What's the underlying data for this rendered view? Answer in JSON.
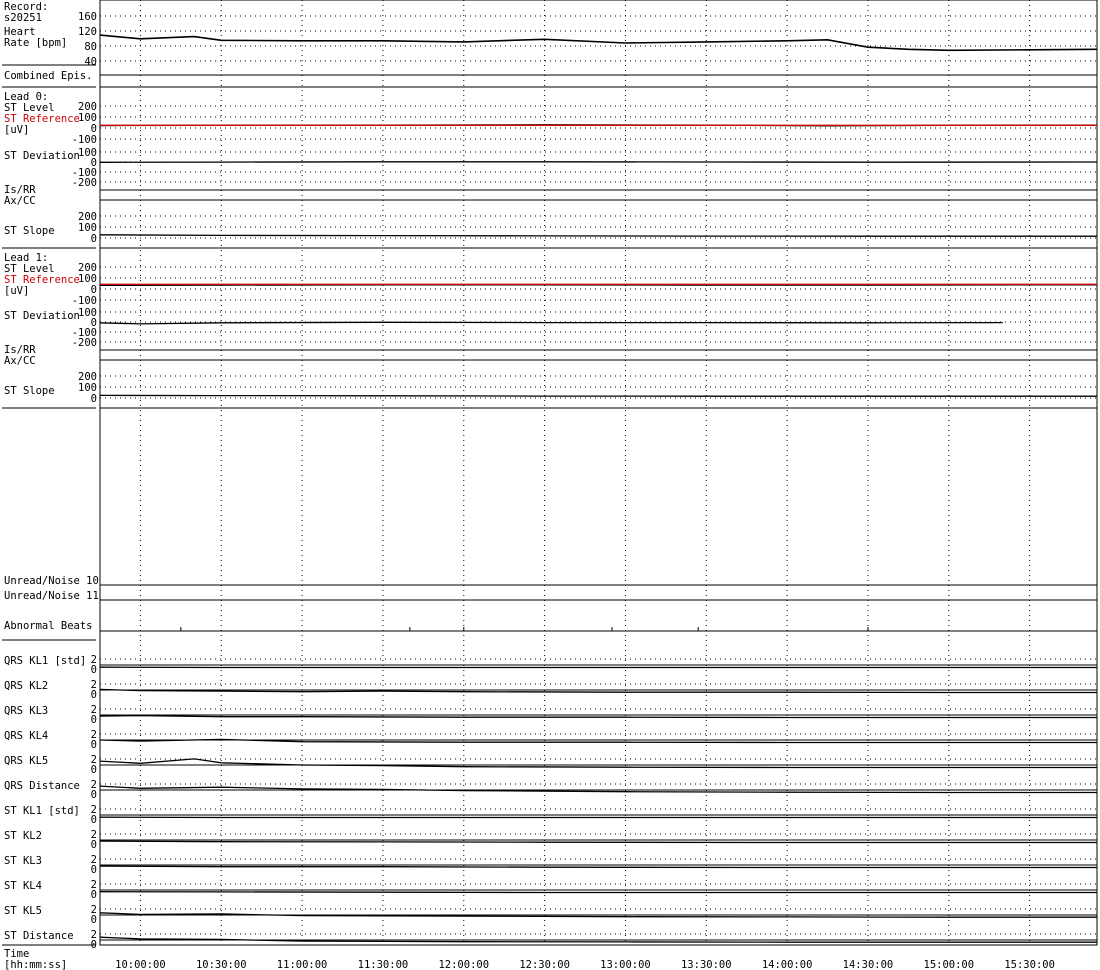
{
  "record": {
    "label": "Record:",
    "id": "s20251"
  },
  "time_axis": {
    "label_line1": "Time",
    "label_line2": "[hh:mm:ss]",
    "ticks": [
      "10:00:00",
      "10:30:00",
      "11:00:00",
      "11:30:00",
      "12:00:00",
      "12:30:00",
      "13:00:00",
      "13:30:00",
      "14:00:00",
      "14:30:00",
      "15:00:00",
      "15:30:00"
    ]
  },
  "colors": {
    "trace": "#000000",
    "reference": "#cc0000",
    "grid": "#000000"
  },
  "panels": [
    {
      "key": "hr",
      "labels": [
        "Heart",
        "Rate [bpm]"
      ],
      "ticks": [
        "160",
        "120",
        "80",
        "40"
      ]
    },
    {
      "key": "combined",
      "labels": [
        "Combined Epis."
      ],
      "ticks": []
    },
    {
      "key": "lead0_level",
      "labels": [
        "Lead 0:",
        "ST Level",
        "ST Reference",
        "[uV]"
      ],
      "ref_label_index": 2,
      "ticks": [
        "200",
        "100",
        "0",
        "-100"
      ]
    },
    {
      "key": "lead0_dev",
      "labels": [
        "ST Deviation"
      ],
      "ticks": [
        "100",
        "0",
        "-100",
        "-200"
      ]
    },
    {
      "key": "lead0_isrr",
      "labels": [
        "Is/RR",
        "Ax/CC"
      ],
      "ticks": []
    },
    {
      "key": "lead0_slope",
      "labels": [
        "ST Slope"
      ],
      "ticks": [
        "200",
        "100",
        "0"
      ]
    },
    {
      "key": "lead1_level",
      "labels": [
        "Lead 1:",
        "ST Level",
        "ST Reference",
        "[uV]"
      ],
      "ref_label_index": 2,
      "ticks": [
        "200",
        "100",
        "0",
        "-100"
      ]
    },
    {
      "key": "lead1_dev",
      "labels": [
        "ST Deviation"
      ],
      "ticks": [
        "100",
        "0",
        "-100",
        "-200"
      ]
    },
    {
      "key": "lead1_isrr",
      "labels": [
        "Is/RR",
        "Ax/CC"
      ],
      "ticks": []
    },
    {
      "key": "lead1_slope",
      "labels": [
        "ST Slope"
      ],
      "ticks": [
        "200",
        "100",
        "0"
      ]
    },
    {
      "key": "empty",
      "labels": [],
      "ticks": []
    },
    {
      "key": "noise10",
      "labels": [
        "Unread/Noise 10"
      ],
      "ticks": []
    },
    {
      "key": "noise11",
      "labels": [
        "Unread/Noise 11"
      ],
      "ticks": []
    },
    {
      "key": "abnormal",
      "labels": [
        "Abnormal Beats"
      ],
      "ticks": []
    },
    {
      "key": "qrs_kl1",
      "labels": [
        "QRS KL1 [std]"
      ],
      "ticks": [
        "2",
        "0"
      ]
    },
    {
      "key": "qrs_kl2",
      "labels": [
        "QRS KL2"
      ],
      "ticks": [
        "2",
        "0"
      ]
    },
    {
      "key": "qrs_kl3",
      "labels": [
        "QRS KL3"
      ],
      "ticks": [
        "2",
        "0"
      ]
    },
    {
      "key": "qrs_kl4",
      "labels": [
        "QRS KL4"
      ],
      "ticks": [
        "2",
        "0"
      ]
    },
    {
      "key": "qrs_kl5",
      "labels": [
        "QRS KL5"
      ],
      "ticks": [
        "2",
        "0"
      ]
    },
    {
      "key": "qrs_dist",
      "labels": [
        "QRS Distance"
      ],
      "ticks": [
        "2",
        "0"
      ]
    },
    {
      "key": "st_kl1",
      "labels": [
        "ST KL1 [std]"
      ],
      "ticks": [
        "2",
        "0"
      ]
    },
    {
      "key": "st_kl2",
      "labels": [
        "ST KL2"
      ],
      "ticks": [
        "2",
        "0"
      ]
    },
    {
      "key": "st_kl3",
      "labels": [
        "ST KL3"
      ],
      "ticks": [
        "2",
        "0"
      ]
    },
    {
      "key": "st_kl4",
      "labels": [
        "ST KL4"
      ],
      "ticks": [
        "2",
        "0"
      ]
    },
    {
      "key": "st_kl5",
      "labels": [
        "ST KL5"
      ],
      "ticks": [
        "2",
        "0"
      ]
    },
    {
      "key": "st_dist",
      "labels": [
        "ST Distance"
      ],
      "ticks": [
        "2",
        "0"
      ]
    }
  ],
  "chart_data": {
    "type": "line",
    "x_unit": "hh:mm:ss",
    "x_range": [
      "09:45:00",
      "15:55:00"
    ],
    "series": [
      {
        "panel": "hr",
        "range": [
          40,
          160
        ],
        "x": [
          "09:45:00",
          "10:00:00",
          "10:20:00",
          "10:30:00",
          "11:00:00",
          "11:30:00",
          "12:00:00",
          "12:30:00",
          "13:00:00",
          "13:30:00",
          "14:00:00",
          "14:15:00",
          "14:30:00",
          "14:45:00",
          "15:00:00",
          "15:30:00",
          "15:55:00"
        ],
        "values": [
          97,
          90,
          94,
          87,
          86,
          86,
          84,
          89,
          82,
          84,
          86,
          88,
          74,
          70,
          68,
          69,
          70
        ]
      },
      {
        "panel": "lead0_level",
        "range": [
          -150,
          250
        ],
        "x": [
          "09:45:00",
          "10:30:00",
          "11:30:00",
          "12:30:00",
          "13:30:00",
          "14:15:00",
          "15:00:00",
          "15:55:00"
        ],
        "values": [
          -12,
          -10,
          -8,
          -6,
          -8,
          -14,
          -10,
          -8
        ]
      },
      {
        "panel": "lead0_level",
        "role": "reference",
        "range": [
          -150,
          250
        ],
        "x": [
          "09:45:00",
          "15:55:00"
        ],
        "values": [
          -10,
          -10
        ]
      },
      {
        "panel": "lead0_dev",
        "range": [
          -250,
          150
        ],
        "x": [
          "09:45:00",
          "10:30:00",
          "11:30:00",
          "12:30:00",
          "13:30:00",
          "14:30:00",
          "15:55:00"
        ],
        "values": [
          -5,
          -3,
          0,
          0,
          -2,
          -4,
          -2
        ]
      },
      {
        "panel": "lead0_slope",
        "range": [
          -25,
          260
        ],
        "x": [
          "09:45:00",
          "10:30:00",
          "11:30:00",
          "12:30:00",
          "13:30:00",
          "14:30:00",
          "15:55:00"
        ],
        "values": [
          12,
          8,
          6,
          4,
          3,
          2,
          2
        ]
      },
      {
        "panel": "lead1_level",
        "range": [
          -150,
          250
        ],
        "x": [
          "09:45:00",
          "10:30:00",
          "11:30:00",
          "12:30:00",
          "13:30:00",
          "14:30:00",
          "15:55:00"
        ],
        "values": [
          -8,
          -6,
          -4,
          -4,
          -6,
          -6,
          -4
        ]
      },
      {
        "panel": "lead1_level",
        "role": "reference",
        "range": [
          -150,
          250
        ],
        "x": [
          "09:45:00",
          "15:55:00"
        ],
        "values": [
          0,
          0
        ]
      },
      {
        "panel": "lead1_dev",
        "range": [
          -250,
          150
        ],
        "x": [
          "09:45:00",
          "10:00:00",
          "10:30:00",
          "11:30:00",
          "12:30:00",
          "13:30:00",
          "14:30:00",
          "15:20:00"
        ],
        "values": [
          -10,
          -20,
          -10,
          -5,
          -8,
          -8,
          -10,
          -8
        ]
      },
      {
        "panel": "lead1_slope",
        "range": [
          -25,
          260
        ],
        "x": [
          "09:45:00",
          "10:30:00",
          "11:30:00",
          "12:30:00",
          "13:30:00",
          "14:30:00",
          "15:55:00"
        ],
        "values": [
          8,
          6,
          5,
          3,
          2,
          2,
          2
        ]
      },
      {
        "panel": "qrs_kl1",
        "range": [
          -0.4,
          3.2
        ],
        "x": [
          "09:45:00",
          "10:30:00",
          "12:00:00",
          "13:30:00",
          "15:55:00"
        ],
        "values": [
          0.1,
          0.05,
          0.05,
          0.05,
          0.05
        ]
      },
      {
        "panel": "qrs_kl2",
        "range": [
          -0.4,
          3.2
        ],
        "x": [
          "09:45:00",
          "10:00:00",
          "10:30:00",
          "11:00:00",
          "11:30:00",
          "12:00:00",
          "13:00:00",
          "14:00:00",
          "15:00:00",
          "15:55:00"
        ],
        "values": [
          0.6,
          0.4,
          0.3,
          0.2,
          0.3,
          0.2,
          0.1,
          0.1,
          0.05,
          0.05
        ]
      },
      {
        "panel": "qrs_kl3",
        "range": [
          -0.4,
          3.2
        ],
        "x": [
          "09:45:00",
          "10:00:00",
          "10:30:00",
          "11:00:00",
          "12:00:00",
          "13:00:00",
          "14:00:00",
          "15:55:00"
        ],
        "values": [
          0.3,
          0.4,
          0.2,
          0.2,
          0.1,
          0.1,
          0.05,
          0.05
        ]
      },
      {
        "panel": "qrs_kl4",
        "range": [
          -0.4,
          3.2
        ],
        "x": [
          "09:45:00",
          "10:00:00",
          "10:30:00",
          "11:00:00",
          "12:00:00",
          "13:00:00",
          "14:00:00",
          "15:00:00",
          "15:55:00"
        ],
        "values": [
          0.5,
          0.3,
          0.6,
          0.2,
          0.1,
          0.1,
          0.05,
          0.05,
          0.05
        ]
      },
      {
        "panel": "qrs_kl5",
        "range": [
          -0.4,
          3.2
        ],
        "x": [
          "09:45:00",
          "10:00:00",
          "10:20:00",
          "10:30:00",
          "11:00:00",
          "11:30:00",
          "12:00:00",
          "13:00:00",
          "14:00:00",
          "15:55:00"
        ],
        "values": [
          1.2,
          0.8,
          1.6,
          0.9,
          0.5,
          0.4,
          0.2,
          0.1,
          0.05,
          0.05
        ]
      },
      {
        "panel": "qrs_dist",
        "range": [
          -0.4,
          3.2
        ],
        "x": [
          "09:45:00",
          "10:00:00",
          "10:30:00",
          "11:00:00",
          "11:30:00",
          "12:00:00",
          "13:00:00",
          "14:00:00",
          "15:00:00",
          "15:55:00"
        ],
        "values": [
          1.2,
          0.8,
          1.0,
          0.7,
          0.6,
          0.4,
          0.2,
          0.1,
          0.05,
          0.05
        ]
      },
      {
        "panel": "st_kl1",
        "range": [
          -0.4,
          3.2
        ],
        "x": [
          "09:45:00",
          "10:30:00",
          "12:00:00",
          "13:30:00",
          "15:55:00"
        ],
        "values": [
          0.1,
          0.05,
          0.05,
          0.05,
          0.05
        ]
      },
      {
        "panel": "st_kl2",
        "range": [
          -0.4,
          3.2
        ],
        "x": [
          "09:45:00",
          "10:30:00",
          "11:30:00",
          "12:30:00",
          "14:00:00",
          "15:55:00"
        ],
        "values": [
          0.3,
          0.2,
          0.15,
          0.1,
          0.05,
          0.05
        ]
      },
      {
        "panel": "st_kl3",
        "range": [
          -0.4,
          3.2
        ],
        "x": [
          "09:45:00",
          "10:30:00",
          "11:30:00",
          "12:30:00",
          "14:00:00",
          "15:55:00"
        ],
        "values": [
          0.3,
          0.2,
          0.2,
          0.1,
          0.05,
          0.05
        ]
      },
      {
        "panel": "st_kl4",
        "range": [
          -0.4,
          3.2
        ],
        "x": [
          "09:45:00",
          "10:30:00",
          "11:30:00",
          "12:30:00",
          "14:00:00",
          "15:55:00"
        ],
        "values": [
          0.2,
          0.15,
          0.1,
          0.05,
          0.05,
          0.05
        ]
      },
      {
        "panel": "st_kl5",
        "range": [
          -0.4,
          3.2
        ],
        "x": [
          "09:45:00",
          "10:00:00",
          "10:30:00",
          "11:00:00",
          "12:00:00",
          "13:00:00",
          "14:00:00",
          "15:00:00",
          "15:55:00"
        ],
        "values": [
          0.9,
          0.6,
          0.7,
          0.4,
          0.3,
          0.2,
          0.15,
          0.1,
          0.1
        ]
      },
      {
        "panel": "st_dist",
        "range": [
          -0.4,
          3.2
        ],
        "x": [
          "09:45:00",
          "10:00:00",
          "10:30:00",
          "11:00:00",
          "12:00:00",
          "13:00:00",
          "14:00:00",
          "15:00:00",
          "15:55:00"
        ],
        "values": [
          1.0,
          0.7,
          0.6,
          0.3,
          0.2,
          0.15,
          0.1,
          0.1,
          0.1
        ]
      }
    ],
    "markers": [
      {
        "panel": "abnormal",
        "x": [
          "10:15:00",
          "11:40:00",
          "12:00:00",
          "12:55:00",
          "13:27:00",
          "14:30:00"
        ]
      }
    ]
  }
}
